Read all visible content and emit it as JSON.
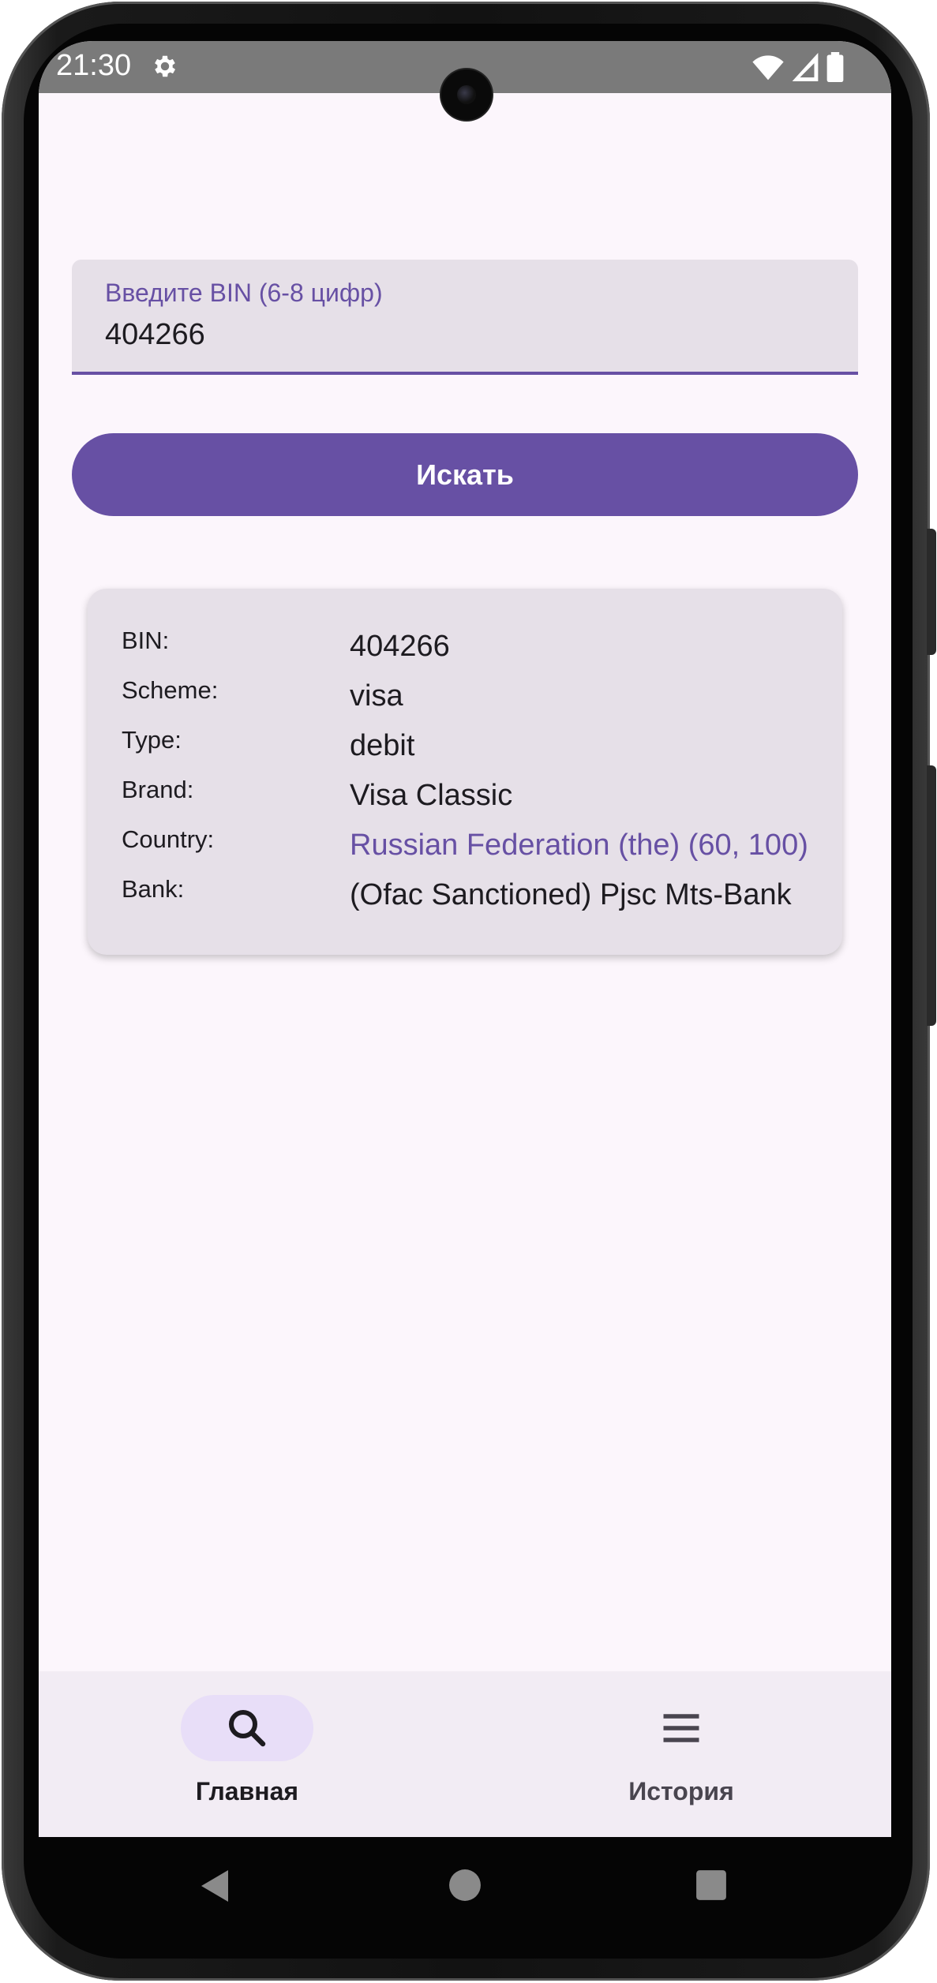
{
  "status_bar": {
    "time": "21:30",
    "settings_icon": "gear-icon",
    "wifi_icon": "wifi-icon",
    "signal_icon": "signal-icon",
    "battery_icon": "battery-icon"
  },
  "bin_input": {
    "label": "Введите BIN (6-8 цифр)",
    "value": "404266"
  },
  "search_button": {
    "label": "Искать"
  },
  "result_card": {
    "rows": [
      {
        "label": "BIN:",
        "value": "404266"
      },
      {
        "label": "Scheme:",
        "value": "visa"
      },
      {
        "label": "Type:",
        "value": "debit"
      },
      {
        "label": "Brand:",
        "value": "Visa Classic"
      },
      {
        "label": "Country:",
        "value": "Russian Federation (the) (60, 100)"
      },
      {
        "label": "Bank:",
        "value": "(Ofac Sanctioned) Pjsc Mts-Bank"
      }
    ]
  },
  "bottom_nav": {
    "items": [
      {
        "label": "Главная",
        "icon": "search-icon",
        "selected": true
      },
      {
        "label": "История",
        "icon": "menu-icon",
        "selected": false
      }
    ]
  },
  "system_nav": {
    "back_icon": "back-triangle-icon",
    "home_icon": "home-circle-icon",
    "recents_icon": "recents-square-icon"
  },
  "colors": {
    "primary": "#6750a4",
    "surface": "#fcf6fc",
    "surface_variant": "#e6e0e8",
    "nav_background": "#f2ecf4",
    "nav_indicator": "#e8def8"
  }
}
